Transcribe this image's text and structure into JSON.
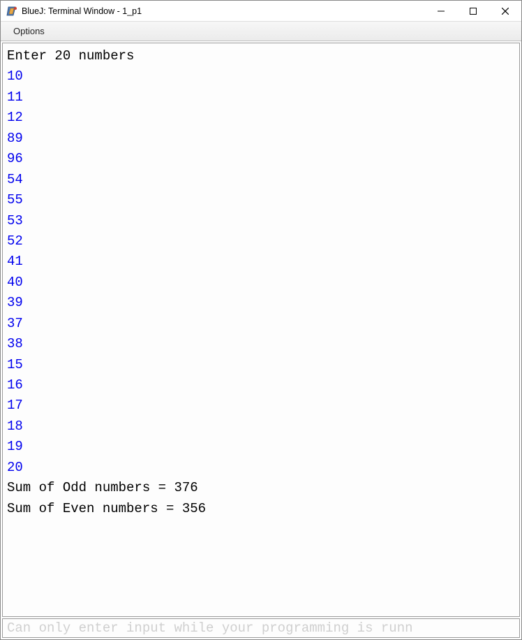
{
  "window": {
    "title": "BlueJ: Terminal Window - 1_p1"
  },
  "menubar": {
    "options": "Options"
  },
  "terminal": {
    "prompt": "Enter 20 numbers",
    "inputs": [
      "10",
      "11",
      "12",
      "89",
      "96",
      "54",
      "55",
      "53",
      "52",
      "41",
      "40",
      "39",
      "37",
      "38",
      "15",
      "16",
      "17",
      "18",
      "19",
      "20"
    ],
    "sum_odd_line": "Sum of Odd numbers = 376",
    "sum_even_line": "Sum of Even numbers = 356"
  },
  "statusbar": {
    "message": "Can only enter input while your programming is runn"
  }
}
